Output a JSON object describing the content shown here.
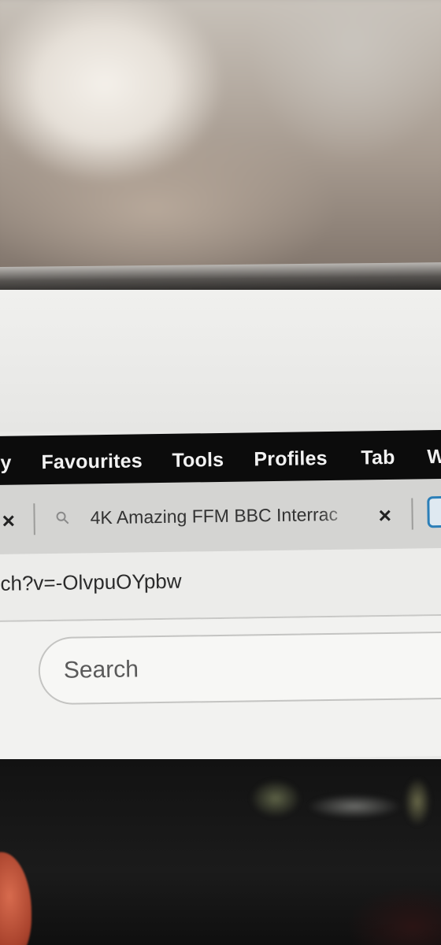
{
  "menubar": {
    "items": [
      "y",
      "Favourites",
      "Tools",
      "Profiles",
      "Tab",
      "W"
    ]
  },
  "tabs": {
    "active_title": "4K Amazing FFM BBC Interrac",
    "close_symbol": "×"
  },
  "address": {
    "url": "ch?v=-OlvpuOYpbw"
  },
  "search": {
    "placeholder": "Search"
  },
  "colors": {
    "menubar_bg": "#0c0c0c",
    "tabstrip_bg": "#d4d4d2",
    "favicon_accent": "#2c7fb8"
  }
}
